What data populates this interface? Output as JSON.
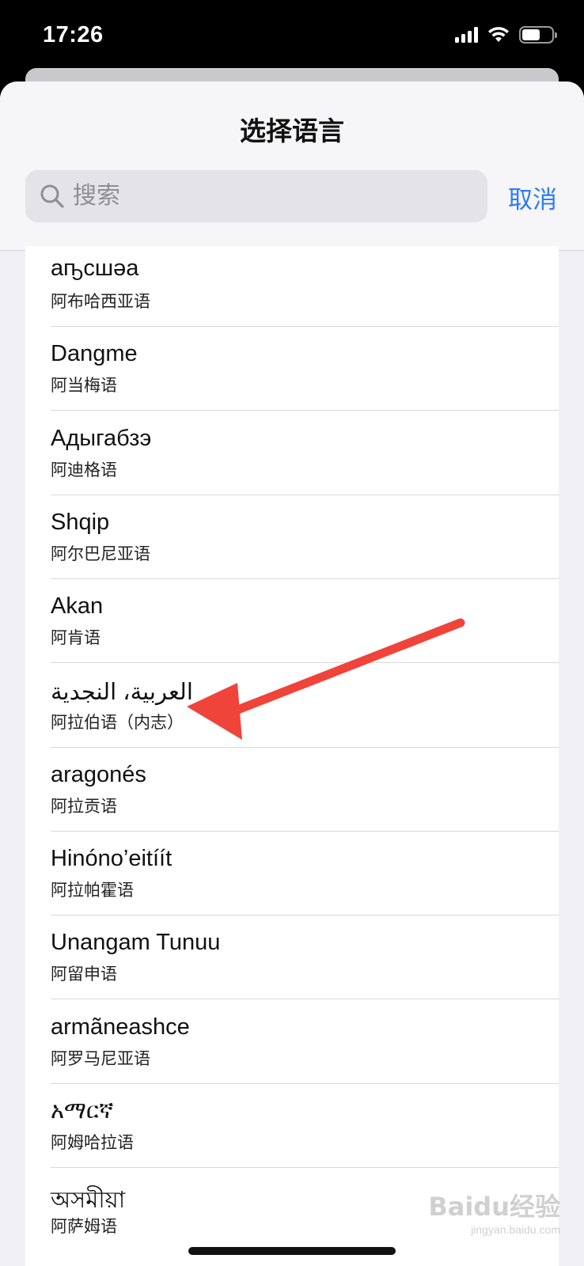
{
  "status_bar": {
    "time": "17:26"
  },
  "sheet": {
    "title": "选择语言",
    "search_placeholder": "搜索",
    "cancel_label": "取消"
  },
  "languages": [
    {
      "native": "аҧсшәа",
      "chinese": "阿布哈西亚语"
    },
    {
      "native": "Dangme",
      "chinese": "阿当梅语"
    },
    {
      "native": "Адыгабзэ",
      "chinese": "阿迪格语"
    },
    {
      "native": "Shqip",
      "chinese": "阿尔巴尼亚语"
    },
    {
      "native": "Akan",
      "chinese": "阿肯语"
    },
    {
      "native": "العربية، النجدية",
      "chinese": "阿拉伯语（内志）"
    },
    {
      "native": "aragonés",
      "chinese": "阿拉贡语"
    },
    {
      "native": "Hinóno’eitíít",
      "chinese": "阿拉帕霍语"
    },
    {
      "native": "Unangam Tunuu",
      "chinese": "阿留申语"
    },
    {
      "native": "armãneashce",
      "chinese": "阿罗马尼亚语"
    },
    {
      "native": "አማርኛ",
      "chinese": "阿姆哈拉语"
    },
    {
      "native": "অসমীয়া",
      "chinese": "阿萨姆语"
    }
  ],
  "colors": {
    "accent": "#2f7cf6",
    "annotation": "#f0433a"
  },
  "watermark": {
    "main": "Baidu经验",
    "sub": "jingyan.baidu.com"
  }
}
